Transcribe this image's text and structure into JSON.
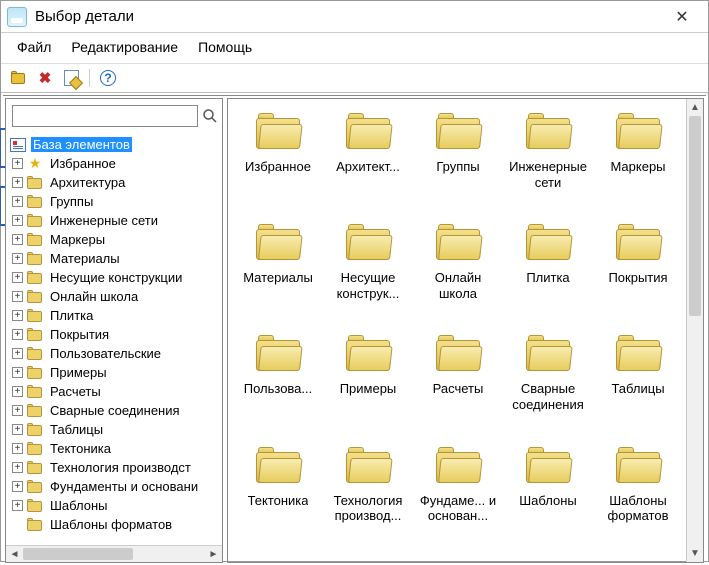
{
  "window": {
    "title": "Выбор детали"
  },
  "menu": {
    "file": "Файл",
    "edit": "Редактирование",
    "help": "Помощь"
  },
  "toolbar": {
    "open": "open-folder",
    "delete": "delete",
    "edit": "edit",
    "help": "help"
  },
  "search": {
    "value": "",
    "placeholder": ""
  },
  "tree": {
    "root": {
      "label": "База элементов",
      "selected": true
    },
    "items": [
      {
        "label": "Избранное",
        "icon": "star",
        "expandable": true
      },
      {
        "label": "Архитектура",
        "icon": "folder",
        "expandable": true
      },
      {
        "label": "Группы",
        "icon": "folder",
        "expandable": true
      },
      {
        "label": "Инженерные сети",
        "icon": "folder",
        "expandable": true
      },
      {
        "label": "Маркеры",
        "icon": "folder",
        "expandable": true
      },
      {
        "label": "Материалы",
        "icon": "folder",
        "expandable": true
      },
      {
        "label": "Несущие конструкции",
        "icon": "folder",
        "expandable": true
      },
      {
        "label": "Онлайн школа",
        "icon": "folder",
        "expandable": true
      },
      {
        "label": "Плитка",
        "icon": "folder",
        "expandable": true
      },
      {
        "label": "Покрытия",
        "icon": "folder",
        "expandable": true
      },
      {
        "label": "Пользовательские",
        "icon": "folder",
        "expandable": true
      },
      {
        "label": "Примеры",
        "icon": "folder",
        "expandable": true
      },
      {
        "label": "Расчеты",
        "icon": "folder",
        "expandable": true
      },
      {
        "label": "Сварные соединения",
        "icon": "folder",
        "expandable": true
      },
      {
        "label": "Таблицы",
        "icon": "folder",
        "expandable": true
      },
      {
        "label": "Тектоника",
        "icon": "folder",
        "expandable": true
      },
      {
        "label": "Технология производст",
        "icon": "folder",
        "expandable": true
      },
      {
        "label": "Фундаменты и основани",
        "icon": "folder",
        "expandable": true
      },
      {
        "label": "Шаблоны",
        "icon": "folder",
        "expandable": true
      },
      {
        "label": "Шаблоны форматов",
        "icon": "folder",
        "expandable": false
      }
    ]
  },
  "grid": {
    "items": [
      {
        "label": "Избранное"
      },
      {
        "label": "Архитект..."
      },
      {
        "label": "Группы"
      },
      {
        "label": "Инженерные сети"
      },
      {
        "label": "Маркеры"
      },
      {
        "label": "Материалы"
      },
      {
        "label": "Несущие конструк..."
      },
      {
        "label": "Онлайн школа"
      },
      {
        "label": "Плитка"
      },
      {
        "label": "Покрытия"
      },
      {
        "label": "Пользова..."
      },
      {
        "label": "Примеры"
      },
      {
        "label": "Расчеты"
      },
      {
        "label": "Сварные соединения"
      },
      {
        "label": "Таблицы"
      },
      {
        "label": "Тектоника"
      },
      {
        "label": "Технология производ..."
      },
      {
        "label": "Фундаме... и основан..."
      },
      {
        "label": "Шаблоны"
      },
      {
        "label": "Шаблоны форматов"
      }
    ]
  }
}
